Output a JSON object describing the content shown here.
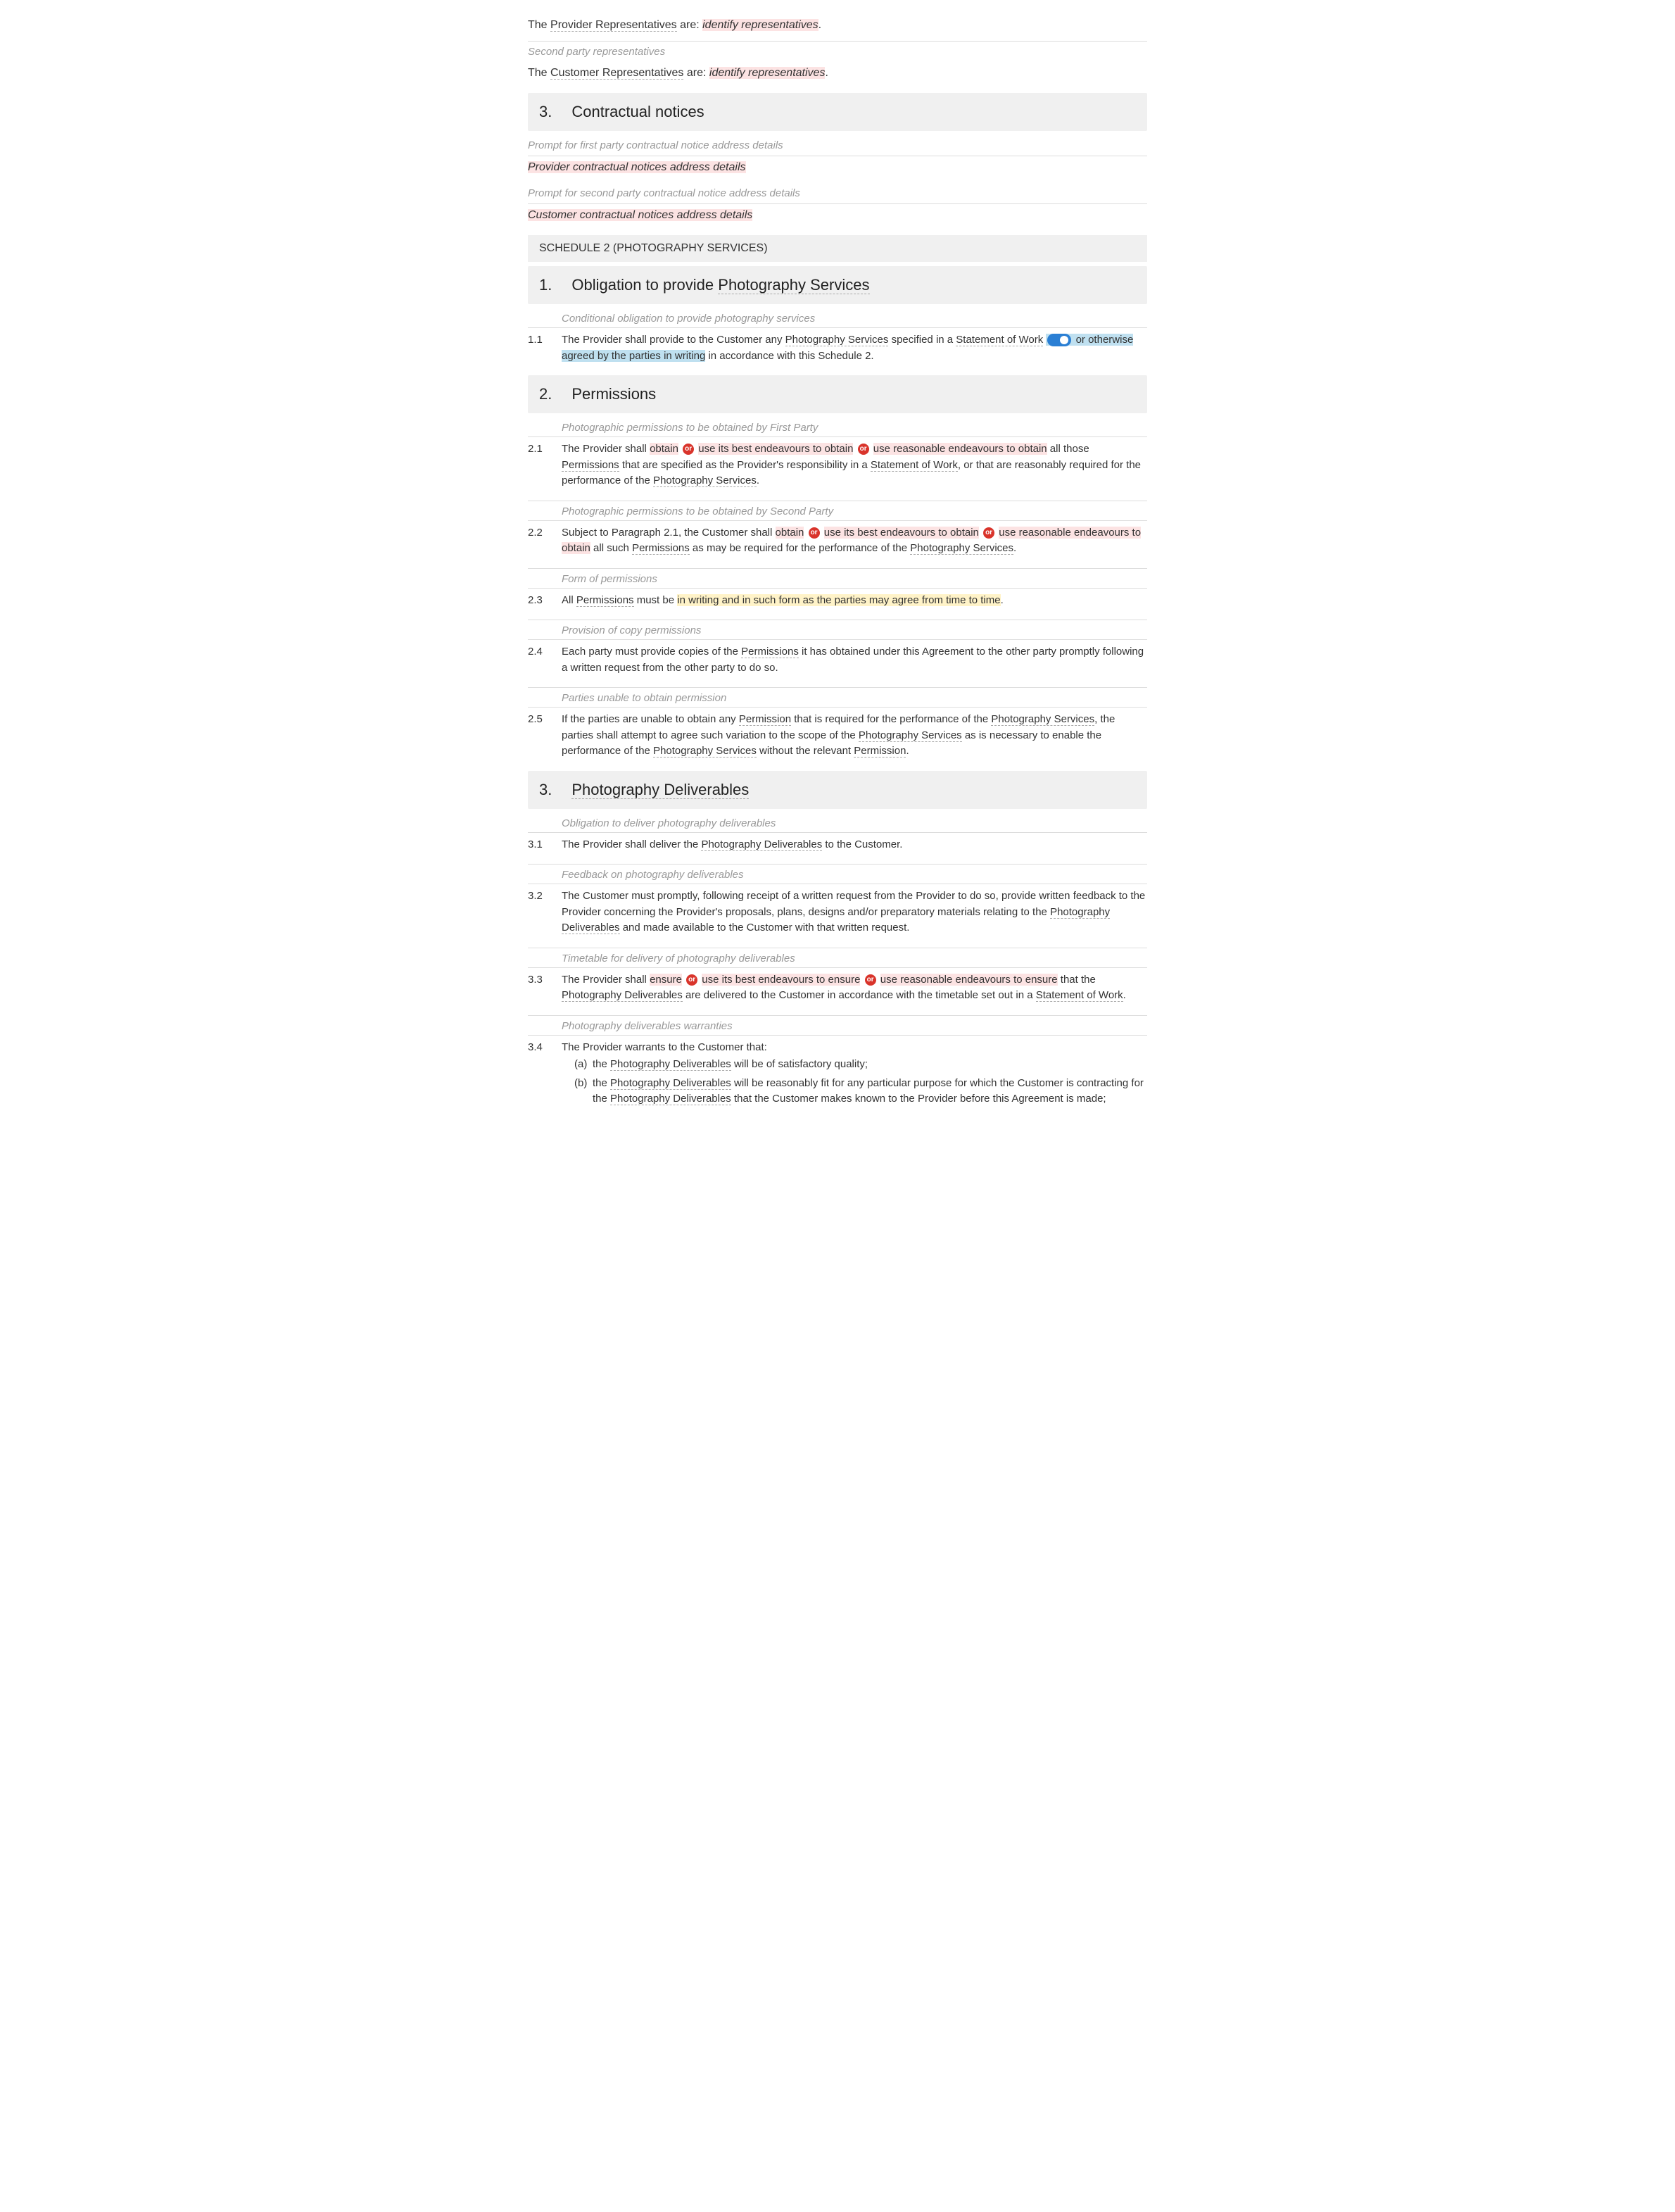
{
  "intro": {
    "line1_prefix": "The ",
    "line1_term": "Provider Representatives",
    "line1_mid": " are: ",
    "line1_field": "identify representatives",
    "line1_suffix": ".",
    "prompt2": "Second party representatives",
    "line2_prefix": "The ",
    "line2_term": "Customer Representatives",
    "line2_mid": " are: ",
    "line2_field": "identify representatives",
    "line2_suffix": "."
  },
  "s3": {
    "num": "3.",
    "title": "Contractual notices",
    "prompt1": "Prompt for first party contractual notice address details",
    "field1": "Provider contractual notices address details",
    "prompt2": "Prompt for second party contractual notice address details",
    "field2": "Customer contractual notices address details"
  },
  "schedule2": "SCHEDULE 2 (PHOTOGRAPHY SERVICES)",
  "h1": {
    "num": "1.",
    "title": "Obligation to provide ",
    "title_term": "Photography Services"
  },
  "c11": {
    "prompt": "Conditional obligation to provide photography services",
    "num": "1.1",
    "p1": "The Provider shall provide to the Customer any ",
    "term1": "Photography Services",
    "p2": " specified in a ",
    "term2": "Statement of Work",
    "p3": " ",
    "opt1a": " or otherwise ",
    "opt1b": "agreed by the parties in writing",
    "p4": " in accordance with this Schedule 2."
  },
  "h2": {
    "num": "2.",
    "title": "Permissions"
  },
  "c21": {
    "prompt": "Photographic permissions to be obtained by First Party",
    "num": "2.1",
    "p1": "The Provider shall ",
    "opt1": "obtain",
    "or": "or",
    "opt2": "use its best endeavours to obtain",
    "opt3": "use reasonable endeavours to obtain",
    "p2": " all those ",
    "term1": "Permissions",
    "p2b": " ",
    "p3": "that are specified as the Provider's responsibility in a ",
    "term2": "Statement of Work",
    "p4": ", or that are reasonably required for the performance of the ",
    "term3": "Photography Services",
    "p5": "."
  },
  "c22": {
    "prompt": "Photographic permissions to be obtained by Second Party",
    "num": "2.2",
    "p1": "Subject to Paragraph 2.1, the Customer shall ",
    "opt1": "obtain",
    "or": "or",
    "opt2": "use its best endeavours to obtain",
    "opt3a": "use reasonable endeavours to ",
    "opt3b": "obtain",
    "p2": " all such ",
    "term1": "Permissions",
    "p3": " as may be required for the performance of the ",
    "term2": "Photography Services",
    "p4": "."
  },
  "c23": {
    "prompt": "Form of permissions",
    "num": "2.3",
    "p1": "All ",
    "term1": "Permissions",
    "p2": " must be ",
    "opt1": "in writing and in such form as the parties may agree from time to time",
    "p3": "."
  },
  "c24": {
    "prompt": "Provision of copy permissions",
    "num": "2.4",
    "p1": "Each party must provide copies of the ",
    "term1": "Permissions",
    "p2": " it has obtained under this Agreement to the other party promptly following a written request from the other party to do so."
  },
  "c25": {
    "prompt": "Parties unable to obtain permission",
    "num": "2.5",
    "p1": "If the parties are unable to obtain any ",
    "term1": "Permission",
    "p2": " that is required for the performance of the ",
    "term2": "Photography Services",
    "p3": ", the parties shall attempt to agree such variation to the scope of the ",
    "term3": "Photography Services",
    "p4": " as is necessary to enable the performance of the ",
    "term4": "Photography Services",
    "p5": " without the relevant ",
    "term5": "Permission",
    "p6": "."
  },
  "h3": {
    "num": "3.",
    "title_term": "Photography Deliverables"
  },
  "c31": {
    "prompt": "Obligation to deliver photography deliverables",
    "num": "3.1",
    "p1": "The Provider shall deliver the ",
    "term1": "Photography Deliverables",
    "p2": " to the Customer."
  },
  "c32": {
    "prompt": "Feedback on photography deliverables",
    "num": "3.2",
    "p1": "The Customer must promptly, following receipt of a written request from the Provider to do so, provide written feedback to the Provider concerning the Provider's proposals, plans, designs and/or preparatory materials relating to the ",
    "term1": "Photography Deliverables",
    "p2": " and made available to the Customer with that written request."
  },
  "c33": {
    "prompt": "Timetable for delivery of photography deliverables",
    "num": "3.3",
    "p1": "The Provider shall ",
    "opt1": "ensure",
    "or": "or",
    "opt2": "use its best endeavours to ensure",
    "opt3": "use reasonable endeavours to ensure",
    "p2": " that the ",
    "term1": "Photography Deliverables",
    "p3": " are delivered to the Customer in accordance with the timetable set out in a ",
    "term2": "Statement of Work",
    "p4": "."
  },
  "c34": {
    "prompt": "Photography deliverables warranties",
    "num": "3.4",
    "p1": "The Provider warrants to the Customer that:",
    "a_letter": "(a)",
    "a_p1": "the ",
    "a_term": "Photography Deliverables",
    "a_p2": " will be of satisfactory quality;",
    "b_letter": "(b)",
    "b_p1": "the ",
    "b_term1": "Photography Deliverables",
    "b_p2": " will be reasonably fit for any particular purpose for which the Customer is contracting for the ",
    "b_term2": "Photography Deliverables",
    "b_p3": " that the Customer makes known to the Provider before this Agreement is made;"
  }
}
